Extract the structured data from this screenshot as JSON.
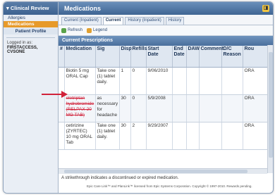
{
  "sidebar": {
    "header": "Clinical Review",
    "items": [
      {
        "label": "Allergies"
      },
      {
        "label": "Medications"
      }
    ],
    "profile_label": "Patient Profile",
    "logged_in_label": "Logged in as:",
    "user_name": "FIRSTACCESS, CVSONE"
  },
  "main": {
    "title": "Medications",
    "tabs": [
      {
        "label": "Current (Inpatient)"
      },
      {
        "label": "Current"
      },
      {
        "label": "History (Inpatient)"
      },
      {
        "label": "History"
      }
    ],
    "toolbar": {
      "refresh_label": "Refresh",
      "legend_label": "Legend"
    },
    "section_title": "Current Prescriptions",
    "columns": [
      "#",
      "Medication",
      "Sig",
      "Disp",
      "Refills",
      "Start Date",
      "End Date",
      "DAW",
      "Comment",
      "D/C Reason",
      "Rou"
    ],
    "rows": [
      {
        "num": "",
        "medication": "Biotin 5 mg ORAL Cap",
        "sig": "Take one (1) tablet daily.",
        "disp": "1",
        "refills": "0",
        "start": "9/06/2010",
        "end": "",
        "daw": "",
        "comment": "",
        "dc_reason": "",
        "route": "ORA"
      },
      {
        "num": "",
        "medication": "eletriptan hydrobromide (RELPAX 20 MG TAB)",
        "sig": "as necessary for headache",
        "disp": "30",
        "refills": "0",
        "start": "5/9/2008",
        "end": "",
        "daw": "",
        "comment": "",
        "dc_reason": "",
        "route": "ORA"
      },
      {
        "num": "",
        "medication": "cetirizine (ZYRTEC) 10 mg ORAL Tab",
        "sig": "Take one (1) tablet daily.",
        "disp": "30",
        "refills": "2",
        "start": "9/29/2007",
        "end": "",
        "daw": "",
        "comment": "",
        "dc_reason": "",
        "route": "ORA"
      }
    ],
    "note": "A strikethrough indicates a discontinued or expired medication.",
    "footer": "Epic Care Link™ and PlanLink™ licensed from Epic Systems Corporation. Copyright © 1997-2010. Rewards pending."
  },
  "colors": {
    "header_blue": "#3f6593",
    "active_orange": "#e79a2a",
    "alert_red": "#d1223a"
  }
}
